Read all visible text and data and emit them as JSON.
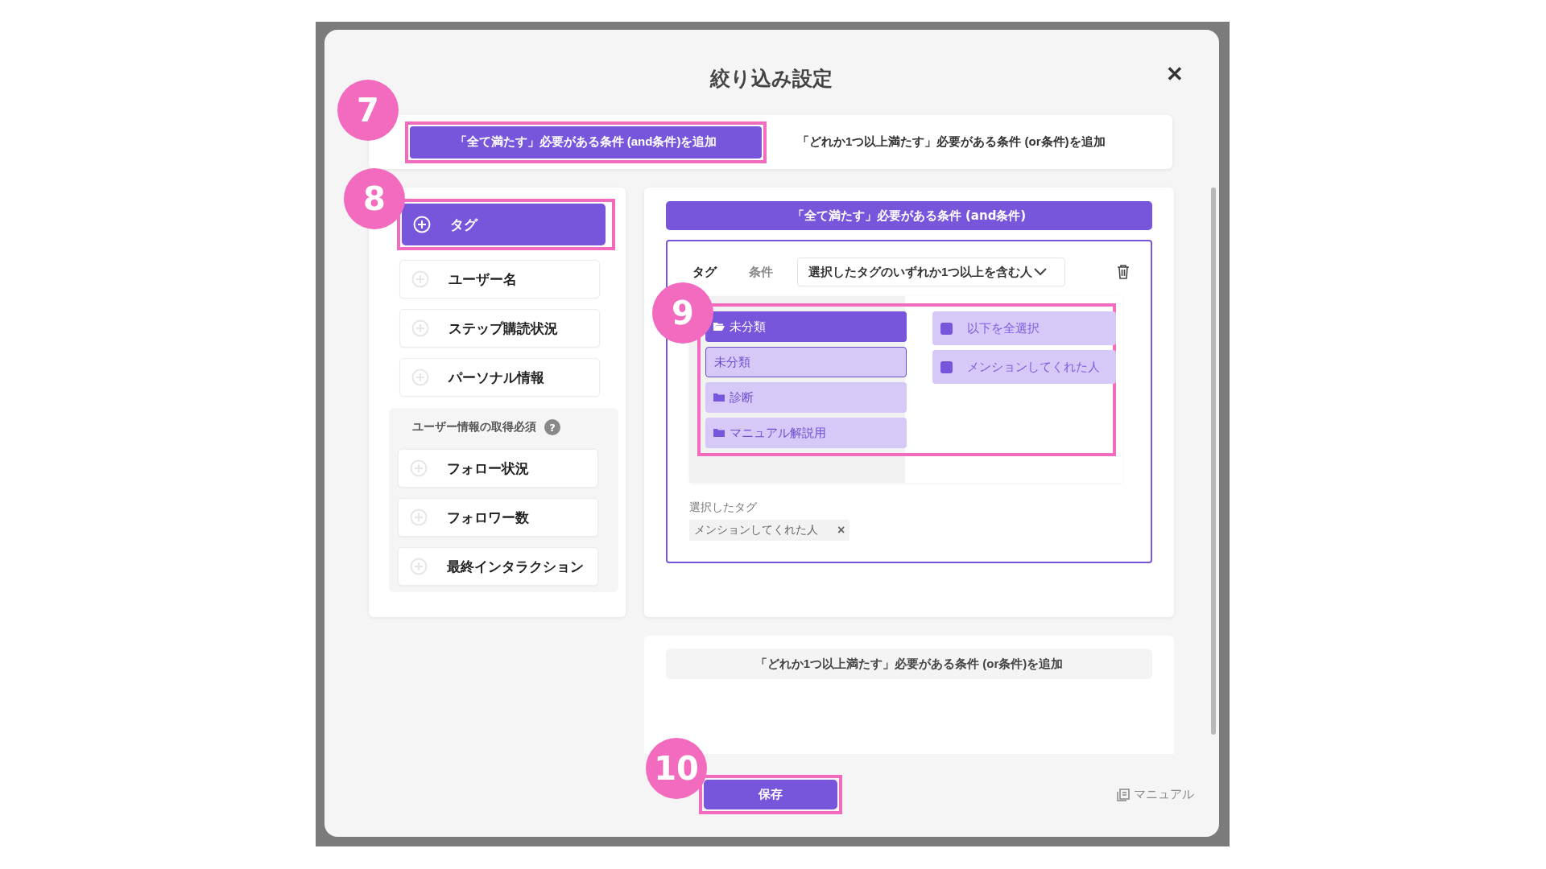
{
  "dialog": {
    "title": "絞り込み設定",
    "close": "✕"
  },
  "tabs": {
    "marker": "7",
    "items": [
      {
        "label": "「全て満たす」必要がある条件 (and条件)を追加",
        "selected": true
      },
      {
        "label": "「どれか1つ以上満たす」必要がある条件 (or条件)を追加",
        "selected": false
      }
    ]
  },
  "condition_types": {
    "marker": "8",
    "items": [
      {
        "label": "タグ",
        "selected": true
      },
      {
        "label": "ユーザー名",
        "selected": false
      },
      {
        "label": "ステップ購読状況",
        "selected": false
      },
      {
        "label": "パーソナル情報",
        "selected": false
      }
    ],
    "required_group": {
      "label": "ユーザー情報の取得必須",
      "help": "?",
      "items": [
        {
          "label": "フォロー状況",
          "selected": false
        },
        {
          "label": "フォロワー数",
          "selected": false
        },
        {
          "label": "最終インタラクション",
          "selected": false
        }
      ]
    }
  },
  "and_section": {
    "header": "「全て満たす」必要がある条件 (and条件)",
    "condition": {
      "field_label": "タグ",
      "condition_label": "条件",
      "dropdown": "選択したタグのいずれか1つ以上を含む人",
      "picker": {
        "marker": "9",
        "folders": [
          {
            "kind": "folder",
            "label": "未分類",
            "selected": true
          },
          {
            "kind": "tag",
            "label": "未分類",
            "selected": false
          },
          {
            "kind": "folder",
            "label": "診断",
            "selected": false
          },
          {
            "kind": "folder",
            "label": "マニュアル解説用",
            "selected": false
          }
        ],
        "options": [
          {
            "label": "以下を全選択"
          },
          {
            "label": "メンションしてくれた人"
          }
        ]
      },
      "selected_label": "選択したタグ",
      "selected_tags": [
        {
          "label": "メンションしてくれた人",
          "remove": "×"
        }
      ]
    }
  },
  "or_section": {
    "button": "「どれか1つ以上満たす」必要がある条件 (or条件)を追加"
  },
  "footer": {
    "marker": "10",
    "save": "保存",
    "manual": "マニュアル"
  }
}
